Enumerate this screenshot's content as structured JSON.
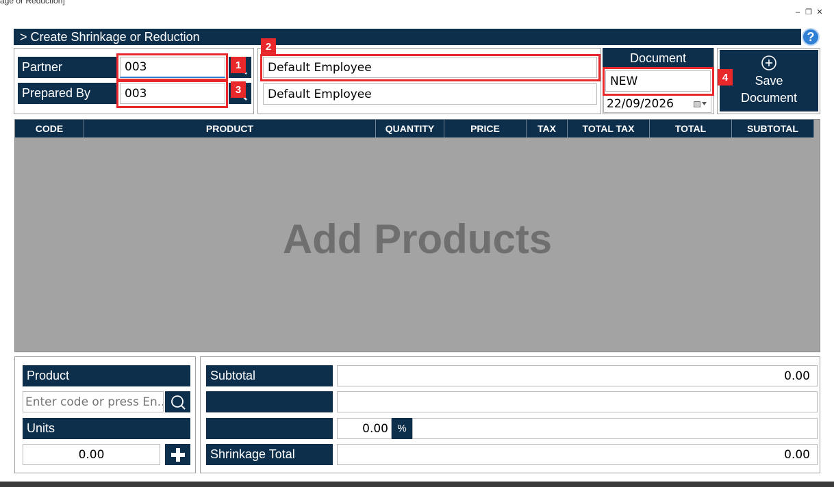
{
  "window": {
    "title": "age or Reduction]",
    "controls": {
      "minimize": "–",
      "restore": "❐",
      "close": "✕"
    }
  },
  "header": {
    "title": "> Create Shrinkage or Reduction",
    "help": "?"
  },
  "partner": {
    "label": "Partner",
    "code": "003",
    "name": "Default Employee"
  },
  "prepared_by": {
    "label": "Prepared By",
    "code": "003",
    "name": "Default Employee"
  },
  "document": {
    "label": "Document",
    "number": "NEW",
    "date": "22/09/2026"
  },
  "save_button": {
    "line1": "Save",
    "line2": "Document"
  },
  "annotations": [
    "1",
    "2",
    "3",
    "4"
  ],
  "table": {
    "columns": [
      "CODE",
      "PRODUCT",
      "QUANTITY",
      "PRICE",
      "TAX",
      "TOTAL TAX",
      "TOTAL",
      "SUBTOTAL"
    ],
    "empty_message": "Add Products"
  },
  "product_entry": {
    "product_label": "Product",
    "search_placeholder": "Enter code or press En...",
    "units_label": "Units",
    "units_value": "0.00"
  },
  "totals": {
    "subtotal_label": "Subtotal",
    "subtotal_value": "0.00",
    "row2_label": "",
    "row2_value": "",
    "discount_label": "",
    "discount_value": "0.00",
    "discount_unit": "%",
    "shrinkage_label": "Shrinkage Total",
    "shrinkage_value": "0.00"
  },
  "colors": {
    "navy": "#0e2f4c",
    "annotation_red": "#e8282b",
    "help_blue": "#2f7fd4",
    "grid_gray": "#a3a3a3"
  }
}
